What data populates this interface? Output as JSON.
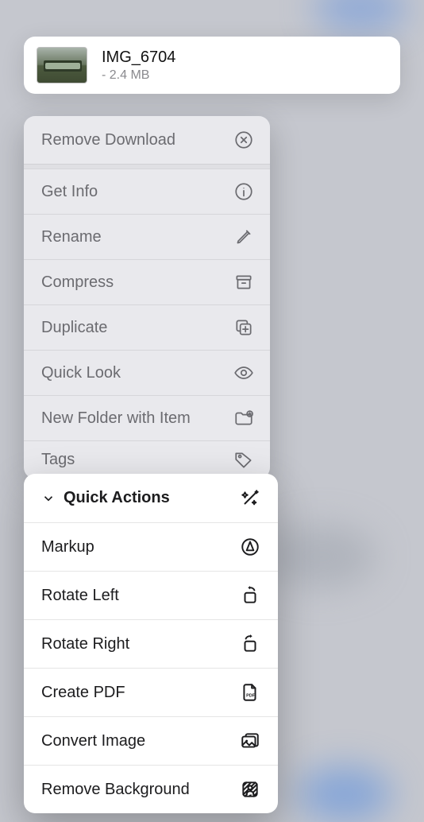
{
  "file": {
    "name": "IMG_6704",
    "size_line": "- 2.4 MB"
  },
  "menu": {
    "remove_download": "Remove Download",
    "get_info": "Get Info",
    "rename": "Rename",
    "compress": "Compress",
    "duplicate": "Duplicate",
    "quick_look": "Quick Look",
    "new_folder": "New Folder with Item",
    "tags": "Tags"
  },
  "quick_actions": {
    "header": "Quick Actions",
    "markup": "Markup",
    "rotate_left": "Rotate Left",
    "rotate_right": "Rotate Right",
    "create_pdf": "Create PDF",
    "convert_image": "Convert Image",
    "remove_background": "Remove Background"
  }
}
